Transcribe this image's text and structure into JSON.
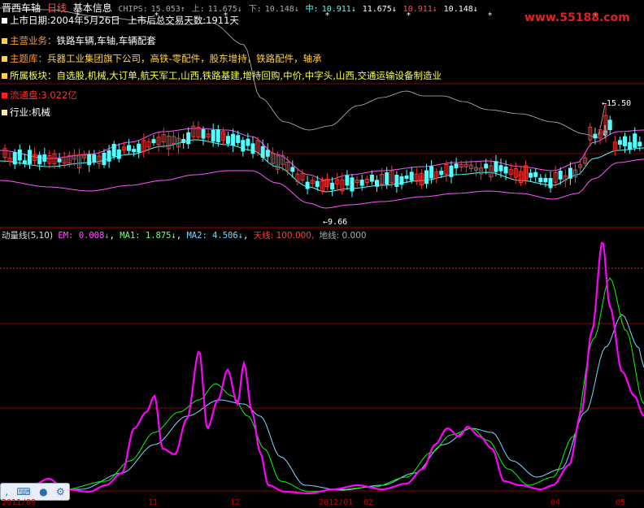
{
  "header": {
    "stock_name": "晋西车轴",
    "period": "日线",
    "basic_info": "基本信息",
    "chips_label": "CHIPS:",
    "chips_value": "15.053↑",
    "up_label": "上:",
    "up_value": "11.675↓",
    "down_label": "下:",
    "down_value": "10.148↓",
    "mid_label": "中:",
    "mid_value": "10.911↓",
    "v5": "11.675↓",
    "v6": "10.911↓",
    "v7": "10.148↓"
  },
  "watermark": "www.55188.com",
  "info": {
    "listing_label": "上市日期:",
    "listing_value": "2004年5月26日",
    "trading_days": "上市后总交易天数:1911天",
    "business_label": "主营业务：",
    "business_value": "铁路车辆,车轴,车辆配套",
    "theme_label": "主题库：",
    "theme_value": "兵器工业集团旗下公司，高铁-零配件，股东增持，铁路配件，轴承",
    "sector_label": "所属板块：",
    "sector_value": "自选股,机械,大订单,航天军工,山西,铁路基建,增持回购,中价,中字头,山西,交通运输设备制造业",
    "float_label": "流通盘:",
    "float_value": "3.022亿",
    "industry_label": "行业:",
    "industry_value": "机械"
  },
  "price_labels": {
    "high": "15.50",
    "low": "9.66"
  },
  "indicator": {
    "name": "动量线(5,10)",
    "em": "EM: 0.008↓",
    "ma1": "MA1: 1.875↓",
    "ma2": "MA2: 4.506↓",
    "sky": "天线: 100.000,",
    "ground": "地线: 0.000"
  },
  "xaxis": [
    "2011/09",
    "11",
    "12",
    "2012/01",
    "02",
    "04",
    "05"
  ],
  "colors": {
    "up": "#ff3232",
    "down": "#54ffff",
    "em_line": "#ff00ff",
    "ma1_line": "#00ff00",
    "ma2_line": "#7fd8ff",
    "band": "#ff55ff",
    "band_inner": "#54ffff",
    "grid": "#8b0000"
  },
  "taskbar": [
    "comma-icon",
    "keyboard-icon",
    "mic-icon",
    "gear-icon"
  ]
}
